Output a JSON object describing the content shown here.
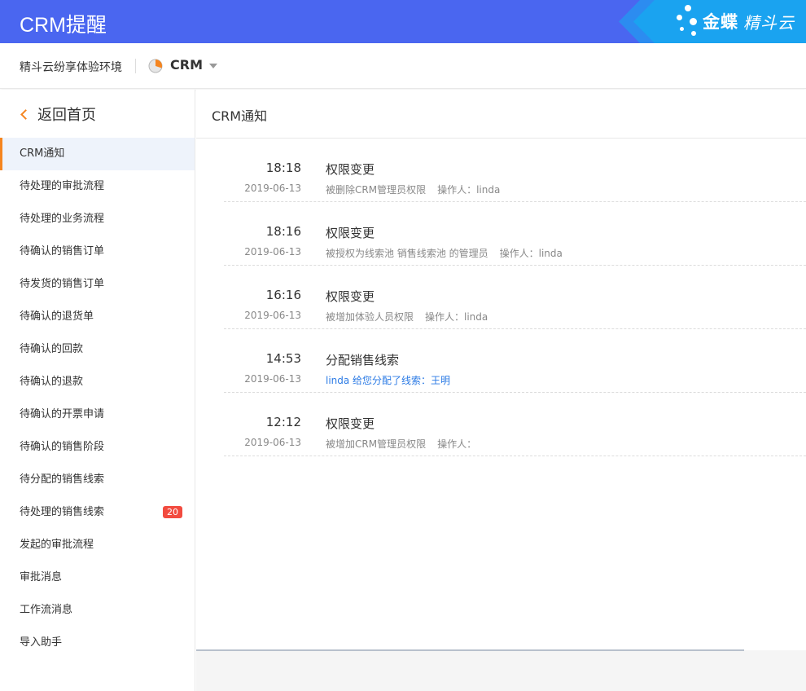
{
  "banner": {
    "title": "CRM提醒",
    "brand_name": "金蝶",
    "brand_sub": "精斗云",
    "colors": {
      "banner": "#4a66f0",
      "brand": "#1aa3f0"
    }
  },
  "subheader": {
    "env_name": "精斗云纷享体验环境",
    "app_name": "CRM",
    "app_icon": "pie-chart-icon"
  },
  "sidebar": {
    "back_label": "返回首页",
    "items": [
      {
        "label": "CRM通知"
      },
      {
        "label": "待处理的审批流程"
      },
      {
        "label": "待处理的业务流程"
      },
      {
        "label": "待确认的销售订单"
      },
      {
        "label": "待发货的销售订单"
      },
      {
        "label": "待确认的退货单"
      },
      {
        "label": "待确认的回款"
      },
      {
        "label": "待确认的退款"
      },
      {
        "label": "待确认的开票申请"
      },
      {
        "label": "待确认的销售阶段"
      },
      {
        "label": "待分配的销售线索"
      },
      {
        "label": "待处理的销售线索",
        "badge": "20"
      },
      {
        "label": "发起的审批流程"
      },
      {
        "label": "审批消息"
      },
      {
        "label": "工作流消息"
      },
      {
        "label": "导入助手"
      }
    ],
    "accent": "#f5851f",
    "badge_color": "#f24b3f"
  },
  "main": {
    "title": "CRM通知",
    "notifications": [
      {
        "time": "18:18",
        "date": "2019-06-13",
        "title": "权限变更",
        "desc": "被删除CRM管理员权限",
        "operator": "操作人：linda"
      },
      {
        "time": "18:16",
        "date": "2019-06-13",
        "title": "权限变更",
        "desc": "被授权为线索池 销售线索池 的管理员",
        "operator": "操作人：linda"
      },
      {
        "time": "16:16",
        "date": "2019-06-13",
        "title": "权限变更",
        "desc": "被增加体验人员权限",
        "operator": "操作人：linda"
      },
      {
        "time": "14:53",
        "date": "2019-06-13",
        "title": "分配销售线索",
        "desc": "linda 给您分配了线索：王明",
        "operator": ""
      },
      {
        "time": "12:12",
        "date": "2019-06-13",
        "title": "权限变更",
        "desc": "被增加CRM管理员权限",
        "operator": "操作人："
      }
    ],
    "link_color": "#2c7be5"
  }
}
